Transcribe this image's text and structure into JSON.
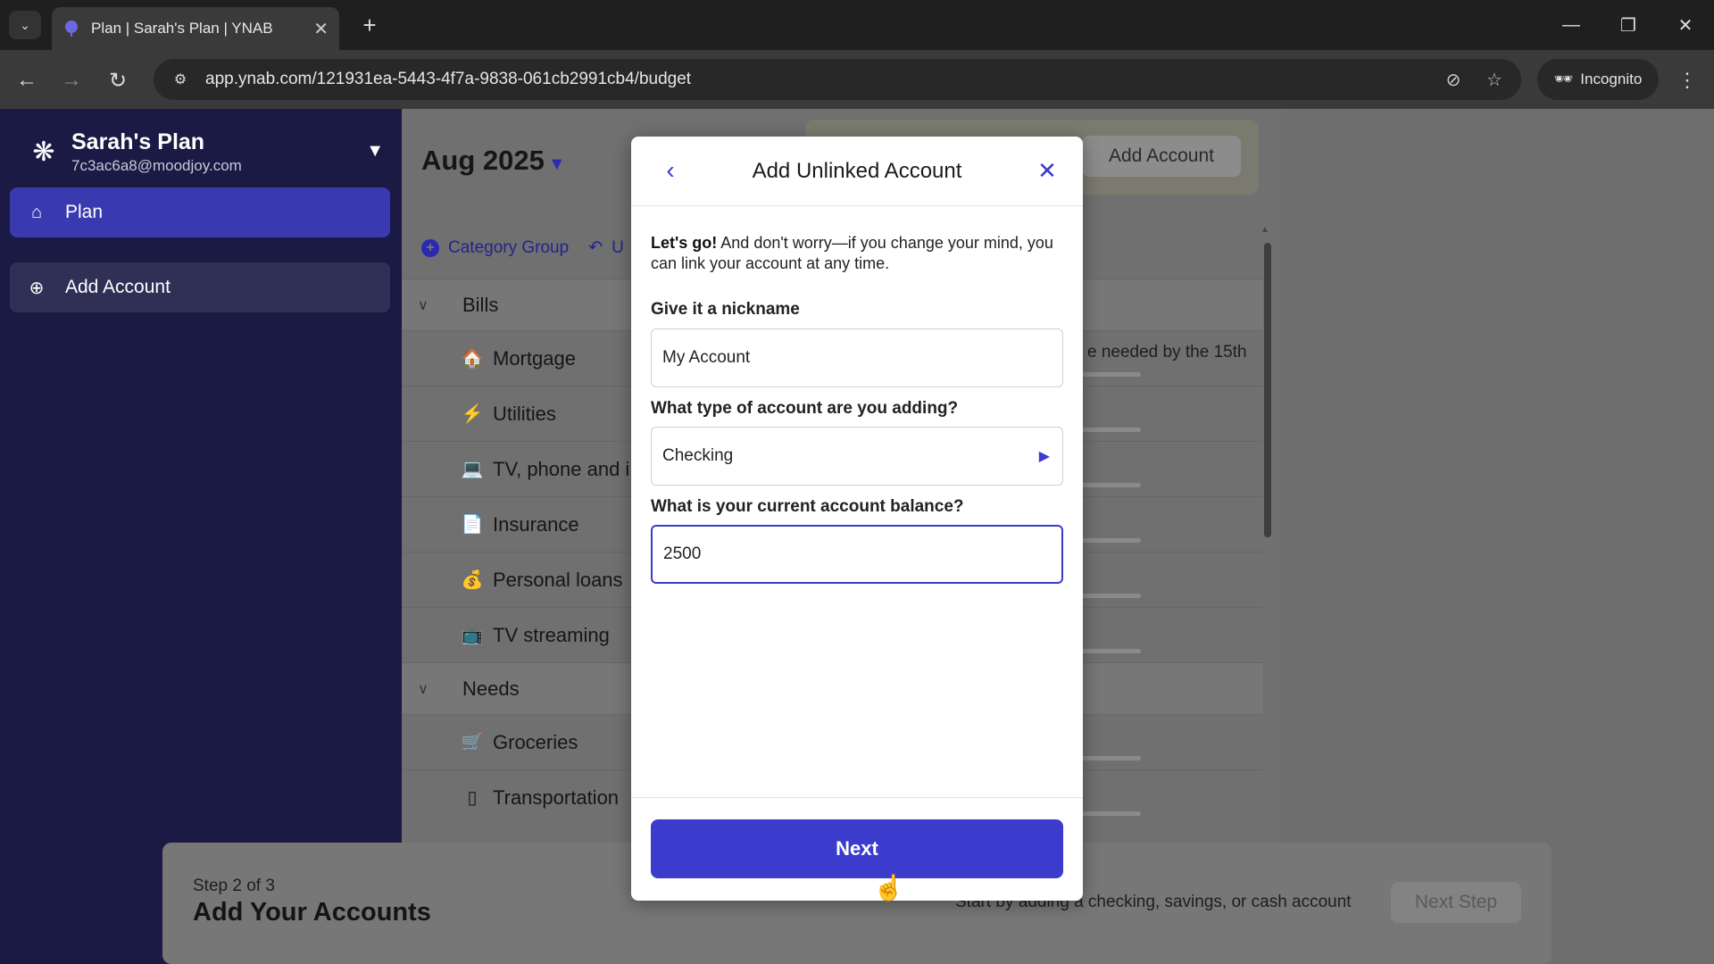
{
  "browser": {
    "tab_title": "Plan | Sarah's Plan | YNAB",
    "url": "app.ynab.com/121931ea-5443-4f7a-9838-061cb2991cb4/budget",
    "incognito_label": "Incognito"
  },
  "sidebar": {
    "plan_name": "Sarah's Plan",
    "plan_email": "7c3ac6a8@moodjoy.com",
    "items": [
      {
        "label": "Plan",
        "icon": "plan-icon"
      },
      {
        "label": "Add Account",
        "icon": "add-circle-icon"
      }
    ]
  },
  "main": {
    "month": "Aug 2025",
    "add_account_label": "Add Account",
    "toolbar": {
      "category_group": "Category Group",
      "undo_partial": "U"
    },
    "groups": [
      {
        "name": "Bills",
        "categories": [
          {
            "name": "Mortgage",
            "icon": "house-icon"
          },
          {
            "name": "Utilities",
            "icon": "lightning-icon"
          },
          {
            "name": "TV, phone and i",
            "icon": "laptop-icon"
          },
          {
            "name": "Insurance",
            "icon": "document-icon"
          },
          {
            "name": "Personal loans",
            "icon": "money-bag-icon"
          },
          {
            "name": "TV streaming",
            "icon": "tv-icon"
          }
        ]
      },
      {
        "name": "Needs",
        "categories": [
          {
            "name": "Groceries",
            "icon": "cart-icon"
          },
          {
            "name": "Transportation",
            "icon": "car-icon"
          }
        ]
      }
    ],
    "needed_text": "e needed by the 15th"
  },
  "modal": {
    "title": "Add Unlinked Account",
    "intro_bold": "Let's go!",
    "intro_rest": " And don't worry—if you change your mind, you can link your account at any time.",
    "nickname_label": "Give it a nickname",
    "nickname_value": "My Account",
    "type_label": "What type of account are you adding?",
    "type_value": "Checking",
    "balance_label": "What is your current account balance?",
    "balance_value": "2500",
    "next_label": "Next"
  },
  "step_banner": {
    "step": "Step 2 of 3",
    "title": "Add Your Accounts",
    "description": "Start by adding a checking, savings, or cash account",
    "next_step_label": "Next Step"
  },
  "colors": {
    "accent": "#3b3bce",
    "sidebar_bg": "#1a1a45",
    "sidebar_active": "#3a3ab0"
  }
}
